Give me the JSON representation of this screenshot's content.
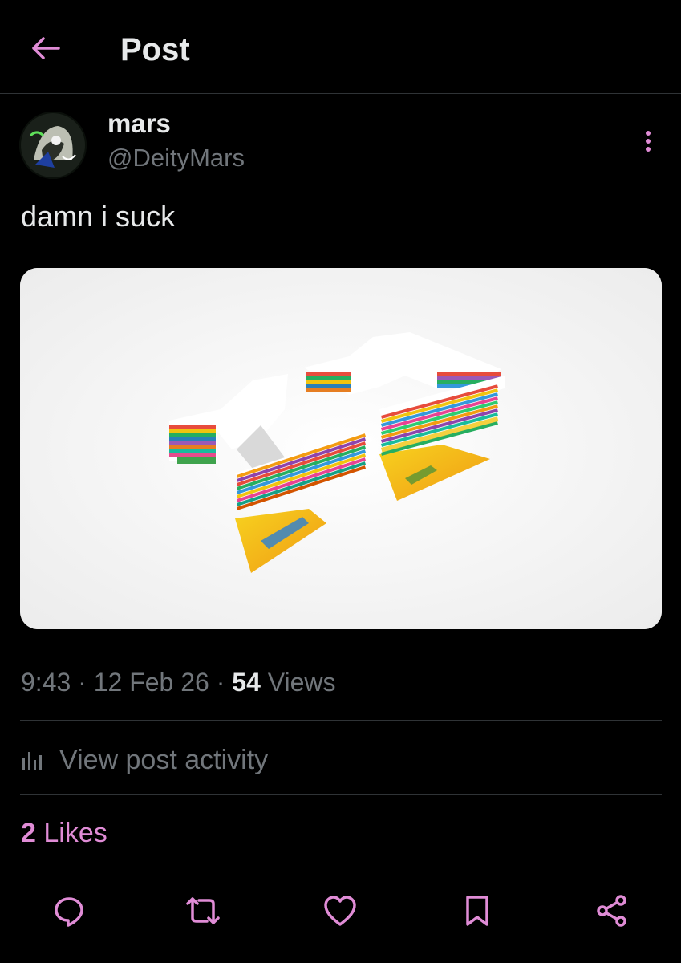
{
  "header": {
    "title": "Post",
    "back_icon": "arrow-left-icon"
  },
  "post": {
    "author_name": "mars",
    "author_handle": "@DeityMars",
    "text": "damn i suck",
    "time": "9:43",
    "date": "12 Feb 26",
    "separator": "·",
    "views_count": "54",
    "views_label": "Views",
    "activity_label": "View post activity",
    "likes_count": "2",
    "likes_label": "Likes"
  },
  "actions": [
    "reply-icon",
    "repost-icon",
    "like-icon",
    "bookmark-icon",
    "share-icon"
  ],
  "colors": {
    "accent": "#e08cd6",
    "background": "#000000",
    "muted": "#71767b",
    "text": "#e7e9ea",
    "divider": "#2f3336"
  }
}
